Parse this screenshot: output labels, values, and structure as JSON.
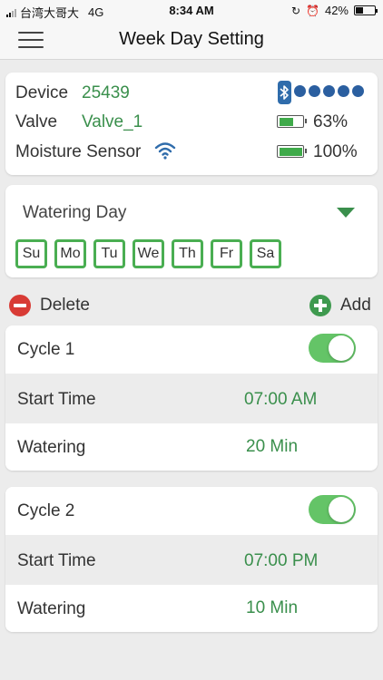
{
  "status_bar": {
    "carrier": "台湾大哥大",
    "network": "4G",
    "time": "8:34 AM",
    "battery_percent": "42%",
    "battery_level": 0.42
  },
  "nav": {
    "title": "Week Day Setting",
    "menu_icon": "hamburger-menu-icon"
  },
  "device": {
    "device_label": "Device",
    "device_value": "25439",
    "valve_label": "Valve",
    "valve_value": "Valve_1",
    "sensor_label": "Moisture Sensor",
    "sensor_icon": "wifi-icon",
    "bluetooth_icon": "bluetooth-icon",
    "signal_dots": 5,
    "valve_battery": "63%",
    "valve_battery_level": 0.63,
    "sensor_battery": "100%",
    "sensor_battery_level": 1.0
  },
  "watering_day": {
    "title": "Watering Day",
    "days": [
      "Su",
      "Mo",
      "Tu",
      "We",
      "Th",
      "Fr",
      "Sa"
    ]
  },
  "actions": {
    "delete_label": "Delete",
    "add_label": "Add"
  },
  "cycles": [
    {
      "name": "Cycle 1",
      "enabled": true,
      "start_label": "Start Time",
      "start_value": "07:00 AM",
      "watering_label": "Watering",
      "watering_value": "20 Min"
    },
    {
      "name": "Cycle 2",
      "enabled": true,
      "start_label": "Start Time",
      "start_value": "07:00 PM",
      "watering_label": "Watering",
      "watering_value": "10 Min"
    }
  ],
  "colors": {
    "accent_green": "#3a8f4c",
    "toggle_on": "#64c467",
    "delete_red": "#d83b35",
    "bluetooth_blue": "#2f6cab"
  }
}
